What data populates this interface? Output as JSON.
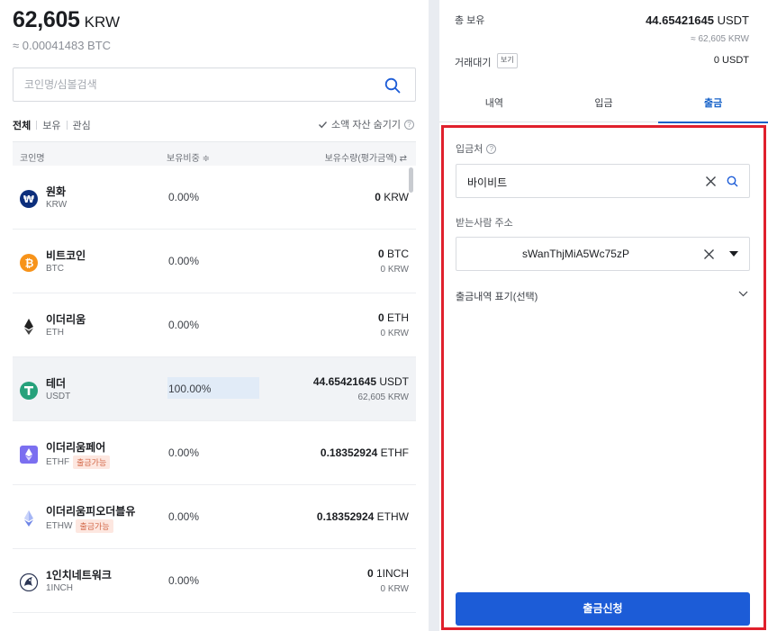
{
  "balance": {
    "amount": "62,605",
    "unit": "KRW",
    "btc_equiv": "≈ 0.00041483 BTC"
  },
  "search": {
    "placeholder": "코인명/심볼검색",
    "icon": "search-icon"
  },
  "filters": {
    "all": "전체",
    "owned": "보유",
    "watch": "관심",
    "hide_small": "소액 자산 숨기기"
  },
  "table": {
    "headers": {
      "coin": "코인명",
      "ratio": "보유비중 ≑",
      "amount": "보유수량(평가금액) ⇄"
    },
    "rows": [
      {
        "name": "원화",
        "symbol": "KRW",
        "icon": "won-icon",
        "ratio": "0.00%",
        "amount": "0",
        "amount_unit": " KRW",
        "krw": ""
      },
      {
        "name": "비트코인",
        "symbol": "BTC",
        "icon": "bitcoin-icon",
        "ratio": "0.00%",
        "amount": "0",
        "amount_unit": " BTC",
        "krw": "0 KRW"
      },
      {
        "name": "이더리움",
        "symbol": "ETH",
        "icon": "ethereum-icon",
        "ratio": "0.00%",
        "amount": "0",
        "amount_unit": " ETH",
        "krw": "0 KRW"
      },
      {
        "name": "테더",
        "symbol": "USDT",
        "icon": "tether-icon",
        "ratio": "100.00%",
        "amount": "44.65421645",
        "amount_unit": " USDT",
        "krw": "62,605 KRW"
      },
      {
        "name": "이더리움페어",
        "symbol": "ETHF",
        "badge": "출금가능",
        "icon": "ethf-icon",
        "ratio": "0.00%",
        "amount": "0.18352924",
        "amount_unit": " ETHF",
        "krw": ""
      },
      {
        "name": "이더리움피오더블유",
        "symbol": "ETHW",
        "badge": "출금가능",
        "icon": "ethw-icon",
        "ratio": "0.00%",
        "amount": "0.18352924",
        "amount_unit": " ETHW",
        "krw": ""
      },
      {
        "name": "1인치네트워크",
        "symbol": "1INCH",
        "icon": "1inch-icon",
        "ratio": "0.00%",
        "amount": "0",
        "amount_unit": " 1INCH",
        "krw": "0 KRW"
      }
    ]
  },
  "summary": {
    "total_label": "총 보유",
    "total_value": "44.65421645",
    "total_unit": " USDT",
    "total_krw": "≈ 62,605 KRW",
    "pending_label": "거래대기",
    "view_label": "보기",
    "pending_value": "0 USDT"
  },
  "tabs": [
    {
      "label": "내역"
    },
    {
      "label": "입금"
    },
    {
      "label": "출금"
    }
  ],
  "withdraw": {
    "dest_label": "입금처",
    "dest_value": "바이비트",
    "addr_label": "받는사람 주소",
    "addr_value": "sWanThjMiA5Wc75zP",
    "memo_label": "출금내역 표기(선택)",
    "submit_label": "출금신청"
  },
  "colors": {
    "accent": "#1c5cd7",
    "tab_active": "#1561c8",
    "highlight_border": "#e0202c",
    "badge": "#d36a4b"
  }
}
